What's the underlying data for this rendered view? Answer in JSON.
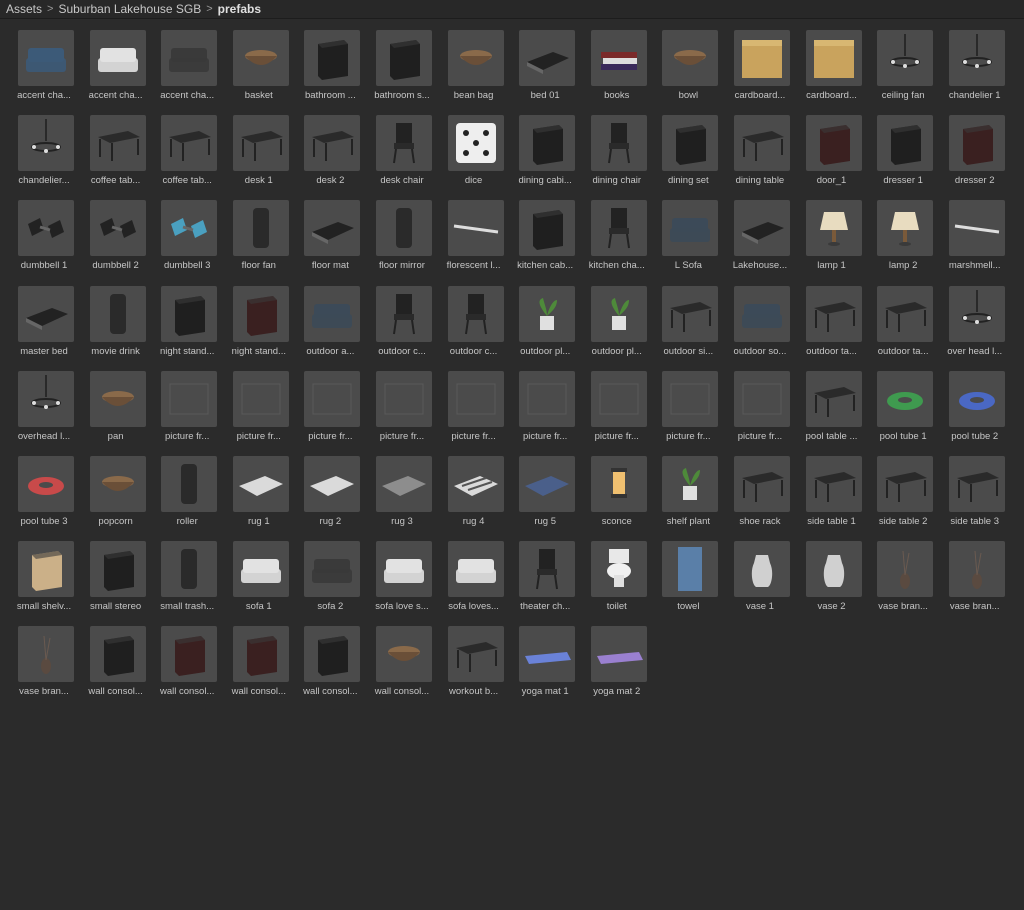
{
  "breadcrumb": {
    "items": [
      "Assets",
      "Suburban Lakehouse SGB",
      "prefabs"
    ],
    "separator": ">"
  },
  "colors": {
    "background": "#2b2b2b",
    "thumb_background": "#4b4b4b",
    "label_text": "#c6c6c6",
    "breadcrumb_current": "#e0e0e0"
  },
  "assets": [
    {
      "label": "accent cha...",
      "icon": "accent-chair-blue-icon"
    },
    {
      "label": "accent cha...",
      "icon": "accent-chair-white-icon"
    },
    {
      "label": "accent cha...",
      "icon": "accent-chair-gray-icon"
    },
    {
      "label": "basket",
      "icon": "basket-icon"
    },
    {
      "label": "bathroom ...",
      "icon": "bathroom-cabinet-icon"
    },
    {
      "label": "bathroom s...",
      "icon": "bathroom-sink-icon"
    },
    {
      "label": "bean bag",
      "icon": "bean-bag-icon"
    },
    {
      "label": "bed 01",
      "icon": "bed-icon"
    },
    {
      "label": "books",
      "icon": "books-icon"
    },
    {
      "label": "bowl",
      "icon": "bowl-icon"
    },
    {
      "label": "cardboard...",
      "icon": "cardboard-box-icon"
    },
    {
      "label": "cardboard...",
      "icon": "cardboard-box-icon"
    },
    {
      "label": "ceiling fan",
      "icon": "ceiling-fan-icon"
    },
    {
      "label": "chandelier 1",
      "icon": "chandelier-icon"
    },
    {
      "label": "chandelier...",
      "icon": "chandelier-ring-icon"
    },
    {
      "label": "coffee tab...",
      "icon": "coffee-table-round-icon"
    },
    {
      "label": "coffee tab...",
      "icon": "coffee-table-dark-icon"
    },
    {
      "label": "desk 1",
      "icon": "desk-icon"
    },
    {
      "label": "desk 2",
      "icon": "desk-corner-icon"
    },
    {
      "label": "desk chair",
      "icon": "desk-chair-icon"
    },
    {
      "label": "dice",
      "icon": "dice-icon"
    },
    {
      "label": "dining cabi...",
      "icon": "dining-cabinet-icon"
    },
    {
      "label": "dining chair",
      "icon": "dining-chair-icon"
    },
    {
      "label": "dining set",
      "icon": "dining-set-icon"
    },
    {
      "label": "dining table",
      "icon": "dining-table-icon"
    },
    {
      "label": "door_1",
      "icon": "door-icon"
    },
    {
      "label": "dresser 1",
      "icon": "dresser-icon"
    },
    {
      "label": "dresser 2",
      "icon": "dresser-brown-icon"
    },
    {
      "label": "dumbbell 1",
      "icon": "dumbbell-icon"
    },
    {
      "label": "dumbbell 2",
      "icon": "dumbbell-icon"
    },
    {
      "label": "dumbbell 3",
      "icon": "dumbbell-blue-icon"
    },
    {
      "label": "floor fan",
      "icon": "floor-fan-icon"
    },
    {
      "label": "floor mat",
      "icon": "floor-mat-icon"
    },
    {
      "label": "floor mirror",
      "icon": "floor-mirror-icon"
    },
    {
      "label": "florescent l...",
      "icon": "fluorescent-light-icon"
    },
    {
      "label": "kitchen cab...",
      "icon": "kitchen-cabinet-icon"
    },
    {
      "label": "kitchen cha...",
      "icon": "kitchen-chair-icon"
    },
    {
      "label": "L Sofa",
      "icon": "l-sofa-icon"
    },
    {
      "label": "Lakehouse...",
      "icon": "lakehouse-icon"
    },
    {
      "label": "lamp 1",
      "icon": "table-lamp-icon"
    },
    {
      "label": "lamp 2",
      "icon": "table-lamp-lit-icon"
    },
    {
      "label": "marshmell...",
      "icon": "marshmallow-stick-icon"
    },
    {
      "label": "master bed",
      "icon": "master-bed-icon"
    },
    {
      "label": "movie drink",
      "icon": "movie-drink-icon"
    },
    {
      "label": "night stand...",
      "icon": "night-stand-icon"
    },
    {
      "label": "night stand...",
      "icon": "night-stand-brown-icon"
    },
    {
      "label": "outdoor a...",
      "icon": "outdoor-chair-icon"
    },
    {
      "label": "outdoor c...",
      "icon": "outdoor-bar-chair-icon"
    },
    {
      "label": "outdoor c...",
      "icon": "outdoor-wood-chair-icon"
    },
    {
      "label": "outdoor pl...",
      "icon": "outdoor-plant-icon"
    },
    {
      "label": "outdoor pl...",
      "icon": "outdoor-plant-white-pot-icon"
    },
    {
      "label": "outdoor si...",
      "icon": "outdoor-side-table-icon"
    },
    {
      "label": "outdoor so...",
      "icon": "outdoor-sofa-icon"
    },
    {
      "label": "outdoor ta...",
      "icon": "outdoor-table-set-icon"
    },
    {
      "label": "outdoor ta...",
      "icon": "outdoor-round-table-icon"
    },
    {
      "label": "over head l...",
      "icon": "overhead-lights-icon"
    },
    {
      "label": "overhead l...",
      "icon": "pendant-light-icon"
    },
    {
      "label": "pan",
      "icon": "pan-icon"
    },
    {
      "label": "picture fr...",
      "icon": "picture-frame-icon"
    },
    {
      "label": "picture fr...",
      "icon": "picture-frame-icon"
    },
    {
      "label": "picture fr...",
      "icon": "picture-frame-icon"
    },
    {
      "label": "picture fr...",
      "icon": "picture-frame-icon"
    },
    {
      "label": "picture fr...",
      "icon": "picture-frame-icon"
    },
    {
      "label": "picture fr...",
      "icon": "picture-frame-icon"
    },
    {
      "label": "picture fr...",
      "icon": "picture-frame-icon"
    },
    {
      "label": "picture fr...",
      "icon": "picture-frame-icon"
    },
    {
      "label": "picture fr...",
      "icon": "picture-frame-icon"
    },
    {
      "label": "pool table ...",
      "icon": "pool-table-icon"
    },
    {
      "label": "pool tube 1",
      "icon": "pool-tube-green-icon"
    },
    {
      "label": "pool tube 2",
      "icon": "pool-tube-blue-icon"
    },
    {
      "label": "pool tube 3",
      "icon": "pool-tube-red-icon"
    },
    {
      "label": "popcorn",
      "icon": "popcorn-bowl-icon"
    },
    {
      "label": "roller",
      "icon": "roller-icon"
    },
    {
      "label": "rug 1",
      "icon": "rug-light-icon"
    },
    {
      "label": "rug 2",
      "icon": "rug-light-icon"
    },
    {
      "label": "rug 3",
      "icon": "rug-gray-icon"
    },
    {
      "label": "rug 4",
      "icon": "rug-striped-icon"
    },
    {
      "label": "rug 5",
      "icon": "rug-pattern-icon"
    },
    {
      "label": "sconce",
      "icon": "sconce-icon"
    },
    {
      "label": "shelf plant",
      "icon": "shelf-plant-icon"
    },
    {
      "label": "shoe rack",
      "icon": "shoe-rack-icon"
    },
    {
      "label": "side table 1",
      "icon": "side-table-icon"
    },
    {
      "label": "side table 2",
      "icon": "side-table-round-icon"
    },
    {
      "label": "side table 3",
      "icon": "side-table-open-icon"
    },
    {
      "label": "small shelv...",
      "icon": "small-shelves-icon"
    },
    {
      "label": "small stereo",
      "icon": "small-stereo-icon"
    },
    {
      "label": "small trash...",
      "icon": "trash-can-icon"
    },
    {
      "label": "sofa 1",
      "icon": "sofa-icon"
    },
    {
      "label": "sofa 2",
      "icon": "sofa-dark-icon"
    },
    {
      "label": "sofa love s...",
      "icon": "love-seat-icon"
    },
    {
      "label": "sofa loves...",
      "icon": "love-seat-icon"
    },
    {
      "label": "theater ch...",
      "icon": "theater-chair-icon"
    },
    {
      "label": "toilet",
      "icon": "toilet-icon"
    },
    {
      "label": "towel",
      "icon": "towel-icon"
    },
    {
      "label": "vase 1",
      "icon": "vase-bowl-icon"
    },
    {
      "label": "vase 2",
      "icon": "vase-white-icon"
    },
    {
      "label": "vase bran...",
      "icon": "vase-branch-icon"
    },
    {
      "label": "vase bran...",
      "icon": "vase-branch-dark-icon"
    },
    {
      "label": "vase bran...",
      "icon": "vase-branch-clear-icon"
    },
    {
      "label": "wall consol...",
      "icon": "wall-console-icon"
    },
    {
      "label": "wall consol...",
      "icon": "wall-console-brown-icon"
    },
    {
      "label": "wall consol...",
      "icon": "wall-console-brown-icon"
    },
    {
      "label": "wall consol...",
      "icon": "wall-console-open-icon"
    },
    {
      "label": "wall consol...",
      "icon": "wall-console-baskets-icon"
    },
    {
      "label": "workout b...",
      "icon": "workout-bench-icon"
    },
    {
      "label": "yoga mat 1",
      "icon": "yoga-mat-blue-icon"
    },
    {
      "label": "yoga mat 2",
      "icon": "yoga-mat-purple-icon"
    }
  ]
}
